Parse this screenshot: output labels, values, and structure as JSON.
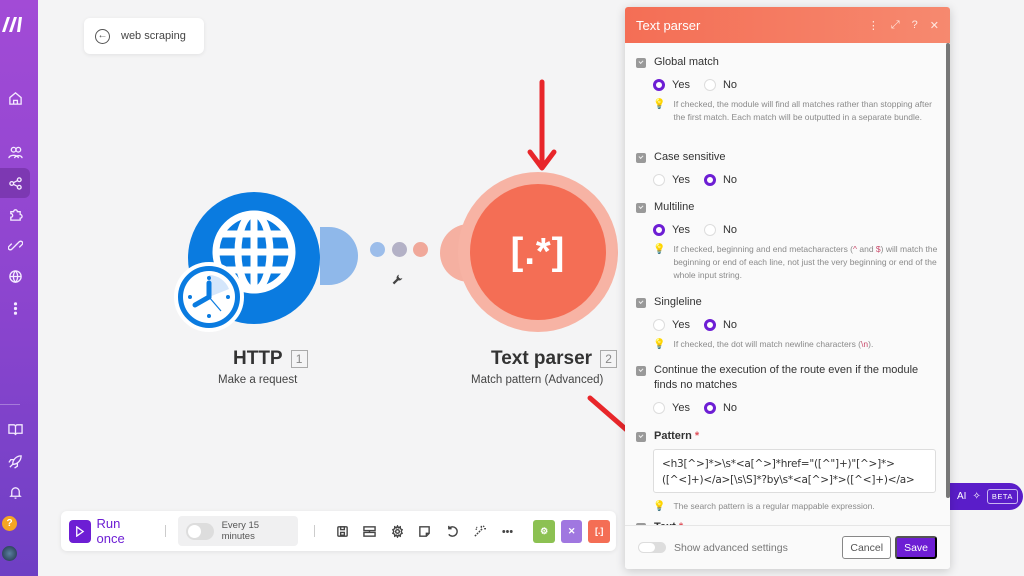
{
  "sidebar": {
    "logo": "M",
    "items": [
      {
        "name": "home",
        "icon": "home-icon"
      },
      {
        "name": "team",
        "icon": "users-icon"
      },
      {
        "name": "scenarios",
        "icon": "share-icon",
        "active": true
      },
      {
        "name": "apps",
        "icon": "puzzle-icon"
      },
      {
        "name": "connections",
        "icon": "link-icon"
      },
      {
        "name": "webhooks",
        "icon": "globe-icon"
      },
      {
        "name": "more",
        "icon": "more-vertical-icon"
      }
    ],
    "bottom_items": [
      {
        "name": "docs",
        "icon": "book-icon"
      },
      {
        "name": "whats-new",
        "icon": "rocket-icon"
      },
      {
        "name": "notifications",
        "icon": "bell-icon"
      }
    ],
    "help_label": "?"
  },
  "scenario": {
    "back_label": "web scraping"
  },
  "nodes": [
    {
      "title": "HTTP",
      "number": "1",
      "subtitle": "Make a request",
      "color": "#0a7be0"
    },
    {
      "title": "Text parser",
      "number": "2",
      "subtitle": "Match pattern (Advanced)",
      "icon_text": "[.*]",
      "color": "#f46e55"
    }
  ],
  "connector": {
    "dot_colors": [
      "#9cbdea",
      "#b3b1c6",
      "#f0a89a"
    ]
  },
  "toolbar": {
    "run_label": "Run once",
    "schedule_label": "Every 15 minutes",
    "schedule_enabled": false,
    "icons": [
      "save-icon",
      "device-icon",
      "settings-icon",
      "notes-icon",
      "undo-icon",
      "magic-wand-icon",
      "more-horizontal-icon"
    ],
    "color_buttons": [
      {
        "name": "tools",
        "color": "#8cc152",
        "glyph": "⚙"
      },
      {
        "name": "flow-control",
        "color": "#a077e0",
        "glyph": "✕"
      },
      {
        "name": "text-parser",
        "color": "#f46e55",
        "glyph": "[.]"
      }
    ]
  },
  "ai_assistant": {
    "label": "AI",
    "badge": "BETA"
  },
  "panel": {
    "title": "Text parser",
    "fields": [
      {
        "label": "Global match",
        "options": [
          "Yes",
          "No"
        ],
        "selected": "Yes",
        "hint": "If checked, the module will find all matches rather than stopping after the first match. Each match will be outputted in a separate bundle."
      },
      {
        "label": "Case sensitive",
        "options": [
          "Yes",
          "No"
        ],
        "selected": "No"
      },
      {
        "label": "Multiline",
        "options": [
          "Yes",
          "No"
        ],
        "selected": "Yes",
        "hint_pre": "If checked, beginning and end metacharacters (",
        "hint_c1": "^",
        "hint_mid": " and ",
        "hint_c2": "$",
        "hint_post": ") will match the beginning or end of each line, not just the very beginning or end of the whole input string."
      },
      {
        "label": "Singleline",
        "options": [
          "Yes",
          "No"
        ],
        "selected": "No",
        "hint_pre": "If checked, the dot will match newline characters (",
        "hint_c1": "\\n",
        "hint_post": ")."
      },
      {
        "label": "Continue the execution of the route even if the module finds no matches",
        "options": [
          "Yes",
          "No"
        ],
        "selected": "No"
      }
    ],
    "pattern": {
      "label": "Pattern",
      "required_mark": "*",
      "value": "<h3[^>]*>\\s*<a[^>]*href=\"([^\"]+)\"[^>]*>([^<]+)</a>[\\s\\S]*?by\\s*<a[^>]*>([^<]+)</a>",
      "hint": "The search pattern is a regular mappable expression."
    },
    "text_field": {
      "label": "Text",
      "required_mark": "*"
    },
    "footer": {
      "advanced_label": "Show advanced settings",
      "cancel_label": "Cancel",
      "save_label": "Save"
    }
  }
}
